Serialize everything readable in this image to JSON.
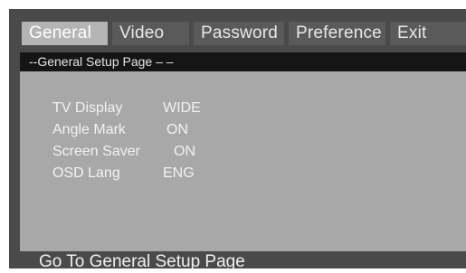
{
  "tabs": [
    {
      "label": "General",
      "active": true
    },
    {
      "label": "Video",
      "active": false
    },
    {
      "label": "Password",
      "active": false
    },
    {
      "label": "Preference",
      "active": false
    },
    {
      "label": "Exit",
      "active": false
    }
  ],
  "panel": {
    "title": "--General Setup Page – –"
  },
  "settings": [
    {
      "label": "TV Display",
      "value": "WIDE"
    },
    {
      "label": "Angle Mark",
      "value": "ON"
    },
    {
      "label": "Screen Saver",
      "value": "ON"
    },
    {
      "label": "OSD Lang",
      "value": "ENG"
    }
  ],
  "status": {
    "text": "Go To General Setup Page"
  },
  "colors": {
    "frame": "#4a4a4a",
    "tab_inactive": "#5a5a5a",
    "tab_active": "#b4b4b4",
    "panel": "#a8a8a8",
    "header": "#151515",
    "text": "#f2f2f2"
  }
}
